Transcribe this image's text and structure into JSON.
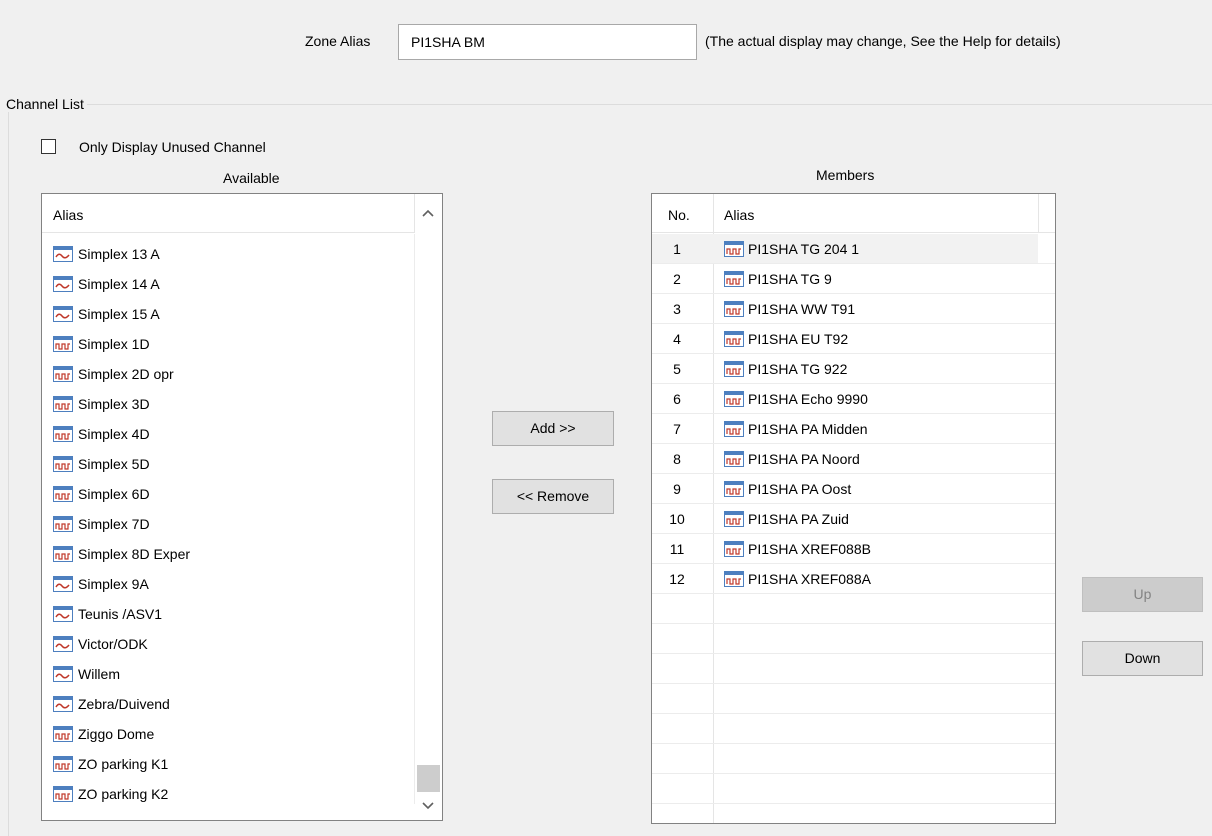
{
  "zone": {
    "label": "Zone Alias",
    "value": "PI1SHA BM",
    "hint": "(The actual display may change, See the Help for details)"
  },
  "channel_list": {
    "group_label": "Channel List",
    "only_unused_label": "Only Display Unused Channel",
    "only_unused_checked": false
  },
  "available": {
    "title": "Available",
    "column_alias": "Alias",
    "items": [
      {
        "alias": "Simplex 13 A",
        "icon": "analog-channel-icon"
      },
      {
        "alias": "Simplex 14 A",
        "icon": "analog-channel-icon"
      },
      {
        "alias": "Simplex 15 A",
        "icon": "analog-channel-icon"
      },
      {
        "alias": "Simplex 1D",
        "icon": "digital-channel-icon"
      },
      {
        "alias": "Simplex 2D opr",
        "icon": "digital-channel-icon"
      },
      {
        "alias": "Simplex 3D",
        "icon": "digital-channel-icon"
      },
      {
        "alias": "Simplex 4D",
        "icon": "digital-channel-icon"
      },
      {
        "alias": "Simplex 5D",
        "icon": "digital-channel-icon"
      },
      {
        "alias": "Simplex 6D",
        "icon": "digital-channel-icon"
      },
      {
        "alias": "Simplex 7D",
        "icon": "digital-channel-icon"
      },
      {
        "alias": "Simplex 8D Exper",
        "icon": "digital-channel-icon"
      },
      {
        "alias": "Simplex 9A",
        "icon": "analog-channel-icon"
      },
      {
        "alias": "Teunis /ASV1",
        "icon": "analog-channel-icon"
      },
      {
        "alias": "Victor/ODK",
        "icon": "analog-channel-icon"
      },
      {
        "alias": "Willem",
        "icon": "analog-channel-icon"
      },
      {
        "alias": "Zebra/Duivend",
        "icon": "analog-channel-icon"
      },
      {
        "alias": "Ziggo Dome",
        "icon": "digital-channel-icon"
      },
      {
        "alias": "ZO parking K1",
        "icon": "digital-channel-icon"
      },
      {
        "alias": "ZO parking K2",
        "icon": "digital-channel-icon"
      }
    ]
  },
  "buttons": {
    "add": "Add >>",
    "remove": "<< Remove",
    "up": "Up",
    "down": "Down"
  },
  "members": {
    "title": "Members",
    "column_no": "No.",
    "column_alias": "Alias",
    "items": [
      {
        "no": "1",
        "alias": "PI1SHA TG 204 1",
        "icon": "digital-channel-icon"
      },
      {
        "no": "2",
        "alias": "PI1SHA TG 9",
        "icon": "digital-channel-icon"
      },
      {
        "no": "3",
        "alias": "PI1SHA WW T91",
        "icon": "digital-channel-icon"
      },
      {
        "no": "4",
        "alias": "PI1SHA EU T92",
        "icon": "digital-channel-icon"
      },
      {
        "no": "5",
        "alias": "PI1SHA TG 922",
        "icon": "digital-channel-icon"
      },
      {
        "no": "6",
        "alias": "PI1SHA Echo 9990",
        "icon": "digital-channel-icon"
      },
      {
        "no": "7",
        "alias": "PI1SHA PA Midden",
        "icon": "digital-channel-icon"
      },
      {
        "no": "8",
        "alias": "PI1SHA PA Noord",
        "icon": "digital-channel-icon"
      },
      {
        "no": "9",
        "alias": "PI1SHA PA Oost",
        "icon": "digital-channel-icon"
      },
      {
        "no": "10",
        "alias": "PI1SHA PA Zuid",
        "icon": "digital-channel-icon"
      },
      {
        "no": "11",
        "alias": "PI1SHA XREF088B",
        "icon": "digital-channel-icon"
      },
      {
        "no": "12",
        "alias": "PI1SHA XREF088A",
        "icon": "digital-channel-icon"
      }
    ]
  }
}
